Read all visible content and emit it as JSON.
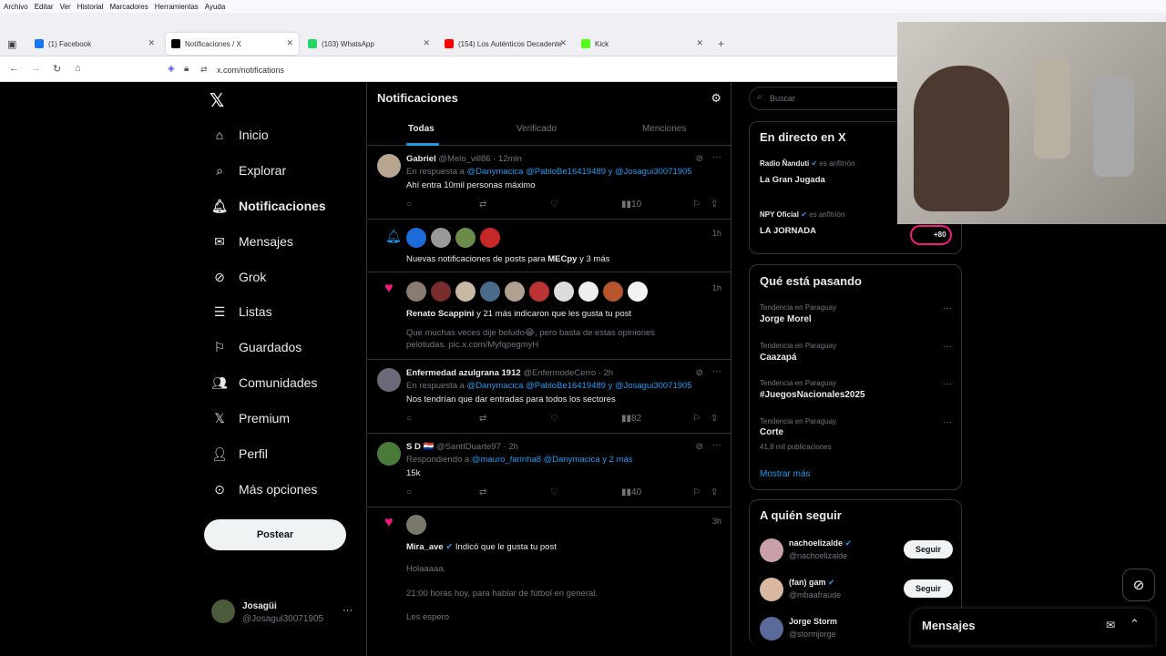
{
  "menu": [
    "Archivo",
    "Editar",
    "Ver",
    "Historial",
    "Marcadores",
    "Herramientas",
    "Ayuda"
  ],
  "tabs": [
    {
      "label": "(1) Facebook",
      "color": "#1877f2"
    },
    {
      "label": "Notificaciones / X",
      "color": "#000000"
    },
    {
      "label": "(103) WhatsApp",
      "color": "#25d366"
    },
    {
      "label": "(154) Los Auténticos Decadente",
      "color": "#ff0000"
    },
    {
      "label": "Kick",
      "color": "#53fc18"
    }
  ],
  "url": "x.com/notifications",
  "nav": [
    "Inicio",
    "Explorar",
    "Notificaciones",
    "Mensajes",
    "Grok",
    "Listas",
    "Guardados",
    "Comunidades",
    "Premium",
    "Perfil",
    "Más opciones"
  ],
  "post_button": "Postear",
  "account": {
    "name": "Josagüi",
    "handle": "@Josagui30071905"
  },
  "center": {
    "title": "Notificaciones",
    "tabs": [
      "Todas",
      "Verificado",
      "Menciones"
    ]
  },
  "notifs": {
    "n1": {
      "name": "Gabriel",
      "handle": "@Melo_vill86 · 12min",
      "reply": "En respuesta a",
      "mentions": "@Danymacica @PabloBe16419489 y @Josagui30071905",
      "text": "Ahí entra 10mil personas máximo",
      "views": "10"
    },
    "n2": {
      "time": "1h",
      "text": "Nuevas notificaciones de posts para",
      "bold": "MECpy",
      "rest": "y 3 más"
    },
    "n3": {
      "time": "1h",
      "bold": "Renato Scappini",
      "text": "y 21 más indicaron que les gusta tu post",
      "quote": "Que muchas veces dije boludo😂, pero basta de estas opiniones pelotudas. pic.x.com/MyfqpegmyH"
    },
    "n4": {
      "name": "Enfermedad azulgrana 1912",
      "handle": "@EnfermodeCerro · 2h",
      "reply": "En respuesta a",
      "mentions": "@Danymacica @PabloBe16419489 y @Josagui30071905",
      "text": "Nos tendrían que dar entradas para todos los sectores",
      "views": "82"
    },
    "n5": {
      "name": "S D 🇵🇾",
      "handle": "@SantIDuarte97 · 2h",
      "reply": "Respondiendo a",
      "mentions": "@mauro_farinha8 @Danymacica y 2 más",
      "text": "15k",
      "views": "40"
    },
    "n6": {
      "time": "3h",
      "bold": "Mira_ave",
      "text": "Indicó que le gusta tu post",
      "l1": "Holaaaaa.",
      "l2": "21:00 horas hoy, para hablar de fútbol en general.",
      "l3": "Les espero"
    }
  },
  "search": "Buscar",
  "live": {
    "title": "En directo en X",
    "s1": "Radio Ñanduti",
    "host": "es anfitrión",
    "s1t": "La Gran Jugada",
    "s2": "NPY Oficial",
    "s2t": "LA JORNADA",
    "count": "+80"
  },
  "trends": {
    "title": "Qué está pasando",
    "items": [
      {
        "ctx": "Tendencia en Paraguay",
        "name": "Jorge Morel",
        "posts": ""
      },
      {
        "ctx": "Tendencia en Paraguay",
        "name": "Caazapá",
        "posts": ""
      },
      {
        "ctx": "Tendencia en Paraguay",
        "name": "#JuegosNacionales2025",
        "posts": ""
      },
      {
        "ctx": "Tendencia en Paraguay",
        "name": "Corte",
        "posts": "41,8 mil publicaciones"
      }
    ],
    "more": "Mostrar más"
  },
  "follow": {
    "title": "A quién seguir",
    "btn": "Seguir",
    "users": [
      {
        "name": "nachoelizalde",
        "handle": "@nachoelizalde"
      },
      {
        "name": "(fan) gam",
        "handle": "@mbaafraude"
      },
      {
        "name": "Jorge Storm",
        "handle": "@stormjorge"
      }
    ]
  },
  "messages": "Mensajes"
}
